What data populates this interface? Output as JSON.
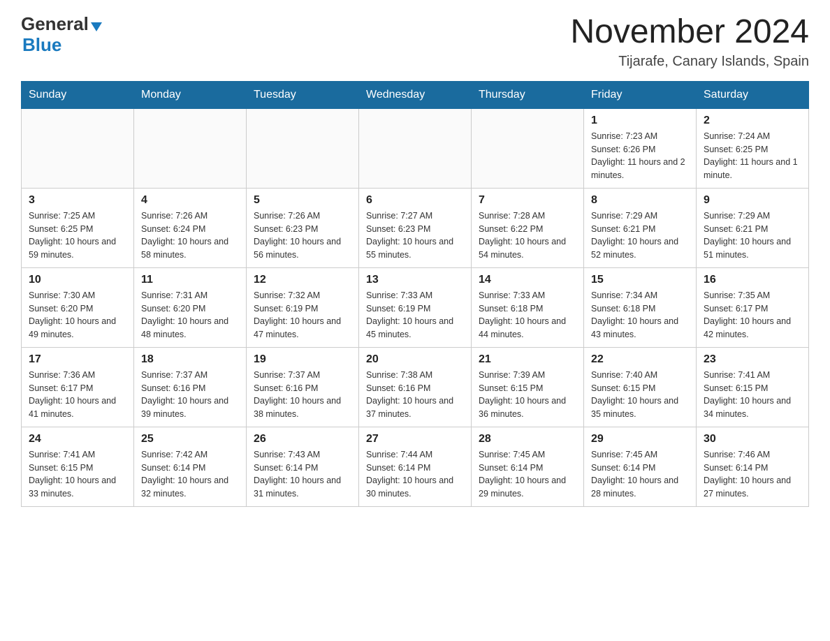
{
  "header": {
    "logo_main": "General",
    "logo_triangle": "▼",
    "logo_blue": "Blue",
    "month_title": "November 2024",
    "location": "Tijarafe, Canary Islands, Spain"
  },
  "weekdays": [
    "Sunday",
    "Monday",
    "Tuesday",
    "Wednesday",
    "Thursday",
    "Friday",
    "Saturday"
  ],
  "weeks": [
    [
      {
        "num": "",
        "info": ""
      },
      {
        "num": "",
        "info": ""
      },
      {
        "num": "",
        "info": ""
      },
      {
        "num": "",
        "info": ""
      },
      {
        "num": "",
        "info": ""
      },
      {
        "num": "1",
        "info": "Sunrise: 7:23 AM\nSunset: 6:26 PM\nDaylight: 11 hours and 2 minutes."
      },
      {
        "num": "2",
        "info": "Sunrise: 7:24 AM\nSunset: 6:25 PM\nDaylight: 11 hours and 1 minute."
      }
    ],
    [
      {
        "num": "3",
        "info": "Sunrise: 7:25 AM\nSunset: 6:25 PM\nDaylight: 10 hours and 59 minutes."
      },
      {
        "num": "4",
        "info": "Sunrise: 7:26 AM\nSunset: 6:24 PM\nDaylight: 10 hours and 58 minutes."
      },
      {
        "num": "5",
        "info": "Sunrise: 7:26 AM\nSunset: 6:23 PM\nDaylight: 10 hours and 56 minutes."
      },
      {
        "num": "6",
        "info": "Sunrise: 7:27 AM\nSunset: 6:23 PM\nDaylight: 10 hours and 55 minutes."
      },
      {
        "num": "7",
        "info": "Sunrise: 7:28 AM\nSunset: 6:22 PM\nDaylight: 10 hours and 54 minutes."
      },
      {
        "num": "8",
        "info": "Sunrise: 7:29 AM\nSunset: 6:21 PM\nDaylight: 10 hours and 52 minutes."
      },
      {
        "num": "9",
        "info": "Sunrise: 7:29 AM\nSunset: 6:21 PM\nDaylight: 10 hours and 51 minutes."
      }
    ],
    [
      {
        "num": "10",
        "info": "Sunrise: 7:30 AM\nSunset: 6:20 PM\nDaylight: 10 hours and 49 minutes."
      },
      {
        "num": "11",
        "info": "Sunrise: 7:31 AM\nSunset: 6:20 PM\nDaylight: 10 hours and 48 minutes."
      },
      {
        "num": "12",
        "info": "Sunrise: 7:32 AM\nSunset: 6:19 PM\nDaylight: 10 hours and 47 minutes."
      },
      {
        "num": "13",
        "info": "Sunrise: 7:33 AM\nSunset: 6:19 PM\nDaylight: 10 hours and 45 minutes."
      },
      {
        "num": "14",
        "info": "Sunrise: 7:33 AM\nSunset: 6:18 PM\nDaylight: 10 hours and 44 minutes."
      },
      {
        "num": "15",
        "info": "Sunrise: 7:34 AM\nSunset: 6:18 PM\nDaylight: 10 hours and 43 minutes."
      },
      {
        "num": "16",
        "info": "Sunrise: 7:35 AM\nSunset: 6:17 PM\nDaylight: 10 hours and 42 minutes."
      }
    ],
    [
      {
        "num": "17",
        "info": "Sunrise: 7:36 AM\nSunset: 6:17 PM\nDaylight: 10 hours and 41 minutes."
      },
      {
        "num": "18",
        "info": "Sunrise: 7:37 AM\nSunset: 6:16 PM\nDaylight: 10 hours and 39 minutes."
      },
      {
        "num": "19",
        "info": "Sunrise: 7:37 AM\nSunset: 6:16 PM\nDaylight: 10 hours and 38 minutes."
      },
      {
        "num": "20",
        "info": "Sunrise: 7:38 AM\nSunset: 6:16 PM\nDaylight: 10 hours and 37 minutes."
      },
      {
        "num": "21",
        "info": "Sunrise: 7:39 AM\nSunset: 6:15 PM\nDaylight: 10 hours and 36 minutes."
      },
      {
        "num": "22",
        "info": "Sunrise: 7:40 AM\nSunset: 6:15 PM\nDaylight: 10 hours and 35 minutes."
      },
      {
        "num": "23",
        "info": "Sunrise: 7:41 AM\nSunset: 6:15 PM\nDaylight: 10 hours and 34 minutes."
      }
    ],
    [
      {
        "num": "24",
        "info": "Sunrise: 7:41 AM\nSunset: 6:15 PM\nDaylight: 10 hours and 33 minutes."
      },
      {
        "num": "25",
        "info": "Sunrise: 7:42 AM\nSunset: 6:14 PM\nDaylight: 10 hours and 32 minutes."
      },
      {
        "num": "26",
        "info": "Sunrise: 7:43 AM\nSunset: 6:14 PM\nDaylight: 10 hours and 31 minutes."
      },
      {
        "num": "27",
        "info": "Sunrise: 7:44 AM\nSunset: 6:14 PM\nDaylight: 10 hours and 30 minutes."
      },
      {
        "num": "28",
        "info": "Sunrise: 7:45 AM\nSunset: 6:14 PM\nDaylight: 10 hours and 29 minutes."
      },
      {
        "num": "29",
        "info": "Sunrise: 7:45 AM\nSunset: 6:14 PM\nDaylight: 10 hours and 28 minutes."
      },
      {
        "num": "30",
        "info": "Sunrise: 7:46 AM\nSunset: 6:14 PM\nDaylight: 10 hours and 27 minutes."
      }
    ]
  ]
}
